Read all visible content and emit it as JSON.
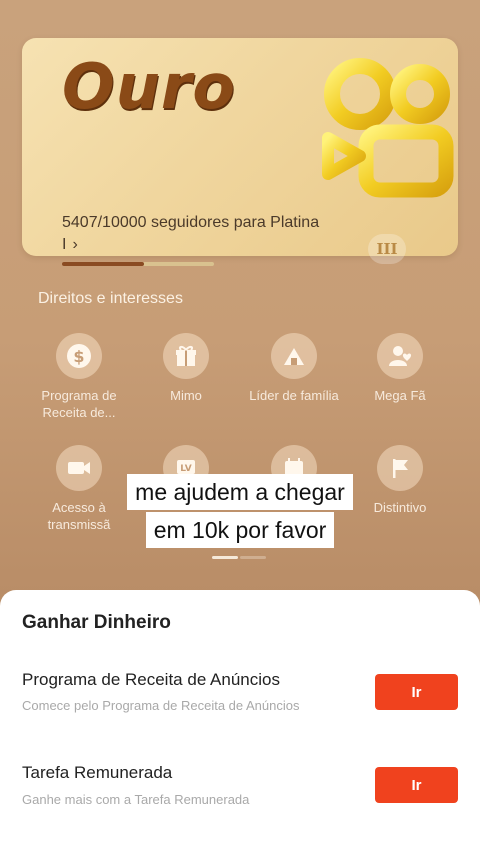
{
  "tier_card": {
    "title": "Ouro",
    "progress_text": "5407/10000 seguidores para Platina I",
    "chevron": "›",
    "progress_fraction": 0.5407,
    "level_badge": "III",
    "logo_icon": "kwai-logo-icon"
  },
  "perks_section": {
    "title": "Direitos e interesses",
    "items": [
      {
        "label": "Programa de Receita de...",
        "icon": "dollar-coin-icon"
      },
      {
        "label": "Mimo",
        "icon": "gift-icon"
      },
      {
        "label": "Líder de família",
        "icon": "house-icon"
      },
      {
        "label": "Mega Fã",
        "icon": "person-heart-icon"
      },
      {
        "label": "Acesso à transmissã",
        "icon": "video-camera-icon"
      },
      {
        "label": "",
        "icon": "badge-icon"
      },
      {
        "label": "",
        "icon": "calendar-icon"
      },
      {
        "label": "Distintivo",
        "icon": "flag-icon"
      }
    ]
  },
  "caption": {
    "line1": "me ajudem a chegar",
    "line2": "em 10k por favor"
  },
  "earn_sheet": {
    "title": "Ganhar Dinheiro",
    "tasks": [
      {
        "title": "Programa de Receita de Anúncios",
        "subtitle": "Comece pelo Programa de Receita de Anúncios",
        "button": "Ir"
      },
      {
        "title": "Tarefa Remunerada",
        "subtitle": "Ganhe mais com a Tarefa Remunerada",
        "button": "Ir"
      }
    ]
  },
  "colors": {
    "accent_button": "#f0421e",
    "card_gold": "#f0d69e",
    "tier_text": "#8a4a17"
  }
}
